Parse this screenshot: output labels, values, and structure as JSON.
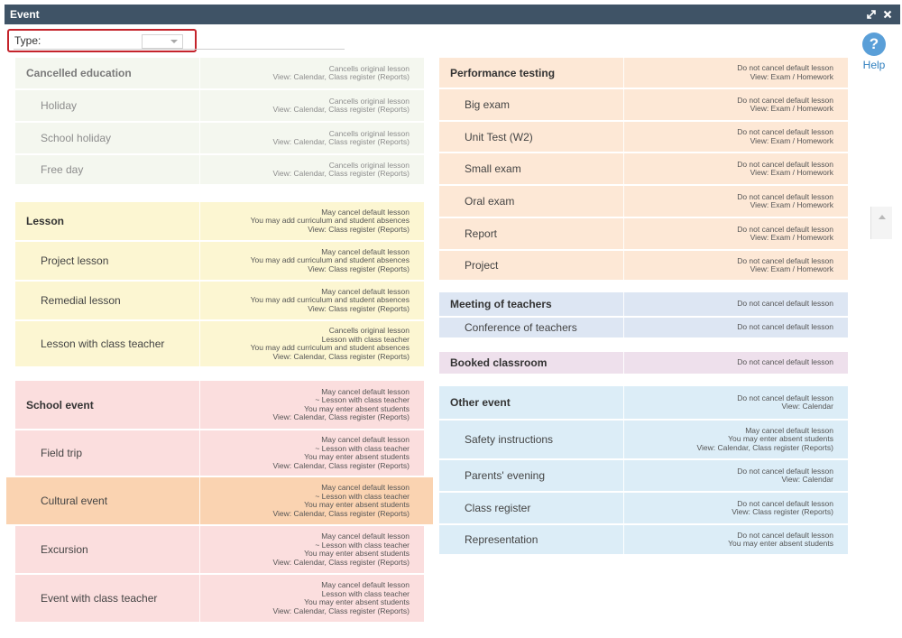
{
  "window": {
    "title": "Event",
    "type_label": "Type:",
    "type_value": "",
    "help_label": "Help",
    "help_glyph": "?"
  },
  "left": [
    {
      "color": "grey",
      "rows": [
        {
          "label": "Cancelled education",
          "header": true,
          "desc": [
            "Cancells original lesson",
            "View: Calendar, Class register (Reports)"
          ]
        },
        {
          "label": "Holiday",
          "desc": [
            "Cancells original lesson",
            "View: Calendar, Class register (Reports)"
          ]
        },
        {
          "label": "School holiday",
          "desc": [
            "Cancells original lesson",
            "View: Calendar, Class register (Reports)"
          ]
        },
        {
          "label": "Free day",
          "desc": [
            "Cancells original lesson",
            "View: Calendar, Class register (Reports)"
          ]
        }
      ]
    },
    {
      "color": "yellow",
      "rows": [
        {
          "label": "Lesson",
          "header": true,
          "desc": [
            "May cancel default lesson",
            "You may add curriculum and student absences",
            "View: Class register (Reports)"
          ]
        },
        {
          "label": "Project lesson",
          "desc": [
            "May cancel default lesson",
            "You may add curriculum and student absences",
            "View: Class register (Reports)"
          ]
        },
        {
          "label": "Remedial lesson",
          "desc": [
            "May cancel default lesson",
            "You may add curriculum and student absences",
            "View: Class register (Reports)"
          ]
        },
        {
          "label": "Lesson with class teacher",
          "desc": [
            "Cancells original lesson",
            "Lesson with class teacher",
            "You may add curriculum and student absences",
            "View: Calendar, Class register (Reports)"
          ]
        }
      ]
    },
    {
      "color": "pink",
      "rows": [
        {
          "label": "School event",
          "header": true,
          "desc": [
            "May cancel default lesson",
            "~ Lesson with class teacher",
            "You may enter absent students",
            "View: Calendar, Class register (Reports)"
          ]
        },
        {
          "label": "Field trip",
          "desc": [
            "May cancel default lesson",
            "~ Lesson with class teacher",
            "You may enter absent students",
            "View: Calendar, Class register (Reports)"
          ]
        },
        {
          "label": "Cultural event",
          "highlight": true,
          "desc": [
            "May cancel default lesson",
            "~ Lesson with class teacher",
            "You may enter absent students",
            "View: Calendar, Class register (Reports)"
          ]
        },
        {
          "label": "Excursion",
          "desc": [
            "May cancel default lesson",
            "~ Lesson with class teacher",
            "You may enter absent students",
            "View: Calendar, Class register (Reports)"
          ]
        },
        {
          "label": "Event with class teacher",
          "desc": [
            "May cancel default lesson",
            "Lesson with class teacher",
            "You may enter absent students",
            "View: Calendar, Class register (Reports)"
          ]
        }
      ]
    }
  ],
  "right": [
    {
      "color": "peach",
      "rows": [
        {
          "label": "Performance testing",
          "header": true,
          "desc": [
            "Do not cancel default lesson",
            "View: Exam / Homework"
          ]
        },
        {
          "label": "Big exam",
          "desc": [
            "Do not cancel default lesson",
            "View: Exam / Homework"
          ]
        },
        {
          "label": "Unit Test (W2)",
          "desc": [
            "Do not cancel default lesson",
            "View: Exam / Homework"
          ]
        },
        {
          "label": "Small exam",
          "desc": [
            "Do not cancel default lesson",
            "View: Exam / Homework"
          ]
        },
        {
          "label": "Oral exam",
          "desc": [
            "Do not cancel default lesson",
            "View: Exam / Homework"
          ]
        },
        {
          "label": "Report",
          "desc": [
            "Do not cancel default lesson",
            "View: Exam / Homework"
          ]
        },
        {
          "label": "Project",
          "desc": [
            "Do not cancel default lesson",
            "View: Exam / Homework"
          ]
        }
      ]
    },
    {
      "color": "blue",
      "rows": [
        {
          "label": "Meeting of teachers",
          "header": true,
          "desc": [
            "Do not cancel default lesson"
          ]
        },
        {
          "label": "Conference of teachers",
          "desc": [
            "Do not cancel default lesson"
          ]
        }
      ]
    },
    {
      "color": "lilac",
      "rows": [
        {
          "label": "Booked classroom",
          "header": true,
          "desc": [
            "Do not cancel default lesson"
          ]
        }
      ]
    },
    {
      "color": "cyan",
      "rows": [
        {
          "label": "Other event",
          "header": true,
          "desc": [
            "Do not cancel default lesson",
            "View: Calendar"
          ]
        },
        {
          "label": "Safety instructions",
          "desc": [
            "May cancel default lesson",
            "You may enter absent students",
            "View: Calendar, Class register (Reports)"
          ]
        },
        {
          "label": "Parents' evening",
          "desc": [
            "Do not cancel default lesson",
            "View: Calendar"
          ]
        },
        {
          "label": "Class register",
          "desc": [
            "Do not cancel default lesson",
            "View: Class register (Reports)"
          ]
        },
        {
          "label": "Representation",
          "desc": [
            "Do not cancel default lesson",
            "You may enter absent students"
          ]
        }
      ]
    }
  ]
}
